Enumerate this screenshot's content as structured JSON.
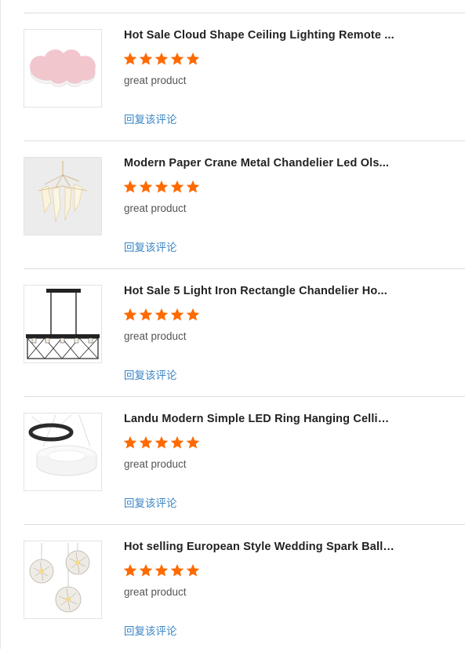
{
  "reviews": [
    {
      "title": "Hot Sale Cloud Shape Ceiling Lighting Remote ...",
      "comment": "great product",
      "rating": 5,
      "reply_label": "回复该评论",
      "image": "pink-cloud-ceiling-lamp"
    },
    {
      "title": "Modern Paper Crane Metal Chandelier Led Ols...",
      "comment": "great product",
      "rating": 5,
      "reply_label": "回复该评论",
      "image": "paper-crane-chandelier"
    },
    {
      "title": "Hot Sale 5 Light Iron Rectangle Chandelier Ho...",
      "comment": "great product",
      "rating": 5,
      "reply_label": "回复该评论",
      "image": "iron-rectangle-chandelier"
    },
    {
      "title": "Landu Modern Simple LED Ring Hanging Cellin...",
      "comment": "great product",
      "rating": 5,
      "reply_label": "回复该评论",
      "image": "led-ring-pendant"
    },
    {
      "title": "Hot selling European Style Wedding Spark Ball ...",
      "comment": "great product",
      "rating": 5,
      "reply_label": "回复该评论",
      "image": "spark-ball-pendants"
    }
  ],
  "colors": {
    "star": "#ff6a00",
    "reply_link": "#3a85c6"
  }
}
